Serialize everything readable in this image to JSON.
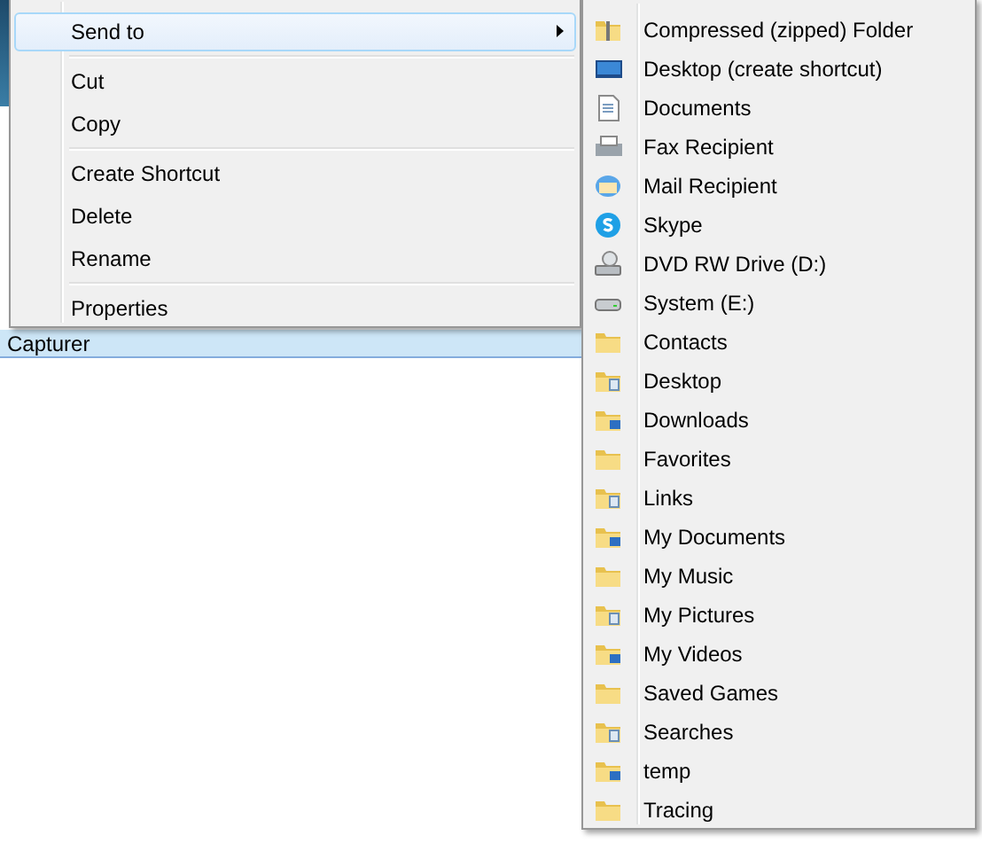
{
  "file_list": {
    "rows": [
      {
        "name": "Capturer",
        "selected": true
      }
    ]
  },
  "context_menu": {
    "items": [
      {
        "kind": "item",
        "label": "Send to",
        "selected": true,
        "submenu": true
      },
      {
        "kind": "separator"
      },
      {
        "kind": "item",
        "label": "Cut",
        "selected": false,
        "submenu": false
      },
      {
        "kind": "item",
        "label": "Copy",
        "selected": false,
        "submenu": false
      },
      {
        "kind": "separator"
      },
      {
        "kind": "item",
        "label": "Create Shortcut",
        "selected": false,
        "submenu": false
      },
      {
        "kind": "item",
        "label": "Delete",
        "selected": false,
        "submenu": false
      },
      {
        "kind": "item",
        "label": "Rename",
        "selected": false,
        "submenu": false
      },
      {
        "kind": "separator"
      },
      {
        "kind": "item",
        "label": "Properties",
        "selected": false,
        "submenu": false
      }
    ]
  },
  "send_to_menu": {
    "items": [
      {
        "kind": "zip",
        "label": "Compressed (zipped) Folder"
      },
      {
        "kind": "desktop",
        "label": "Desktop (create shortcut)"
      },
      {
        "kind": "document",
        "label": "Documents"
      },
      {
        "kind": "fax",
        "label": "Fax Recipient"
      },
      {
        "kind": "mail",
        "label": "Mail Recipient"
      },
      {
        "kind": "skype",
        "label": "Skype"
      },
      {
        "kind": "dvd",
        "label": "DVD RW Drive (D:)"
      },
      {
        "kind": "drive",
        "label": "System (E:)"
      },
      {
        "kind": "folder",
        "label": "Contacts"
      },
      {
        "kind": "folder",
        "label": "Desktop"
      },
      {
        "kind": "folder",
        "label": "Downloads"
      },
      {
        "kind": "folder",
        "label": "Favorites"
      },
      {
        "kind": "folder",
        "label": "Links"
      },
      {
        "kind": "folder",
        "label": "My Documents"
      },
      {
        "kind": "folder",
        "label": "My Music"
      },
      {
        "kind": "folder",
        "label": "My Pictures"
      },
      {
        "kind": "folder",
        "label": "My Videos"
      },
      {
        "kind": "folder",
        "label": "Saved Games"
      },
      {
        "kind": "folder",
        "label": "Searches"
      },
      {
        "kind": "folder",
        "label": "temp"
      },
      {
        "kind": "folder",
        "label": "Tracing"
      }
    ]
  }
}
